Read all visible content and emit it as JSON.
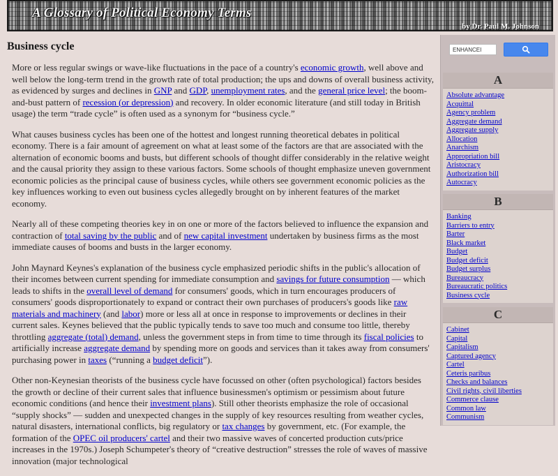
{
  "header": {
    "title": "A Glossary of Political Economy Terms",
    "author": "by Dr. Paul M. Johnson"
  },
  "article": {
    "title": "Business cycle",
    "p1": {
      "t1": "More or less regular swings or wave-like fluctuations in the pace of a country's ",
      "l1": "economic growth",
      "t2": ", well above and well below the long-term trend in the growth rate of total production; the ups and downs of overall business activity, as evidenced by surges and declines in ",
      "l2": "GNP",
      "t3": " and ",
      "l3": "GDP",
      "t4": ", ",
      "l4": "unemployment rates",
      "t5": ", and the ",
      "l5": "general price level",
      "t6": "; the boom-and-bust pattern of ",
      "l6": "recession (or depression)",
      "t7": " and recovery. In older economic literature (and still today in British usage) the term “trade cycle” is often used as a synonym for “business cycle.”"
    },
    "p2": "What causes business cycles has been one of the hottest and longest running theoretical debates in political economy. There is a fair amount of agreement on what at least some of the factors are that are associated with the alternation of economic booms and busts, but different schools of thought differ considerably in the relative weight and the causal priority they assign to these various factors. Some schools of thought emphasize uneven government economic policies as the principal cause of business cycles, while others see government economic policies as the key influences working to even out business cycles allegedly brought on by inherent features of the market economy.",
    "p3": {
      "t1": "Nearly all of these competing theories key in on one or more of the factors believed to influence the expansion and contraction of ",
      "l1": "total saving by the public",
      "t2": " and of ",
      "l2": "new capital investment",
      "t3": " undertaken by business firms as the most immediate causes of booms and busts in the larger economy."
    },
    "p4": {
      "t1": "John Maynard Keynes's explanation of the business cycle emphasized periodic shifts in the public's allocation of their incomes between current spending for immediate consumption and ",
      "l1": "savings for future consumption",
      "t2": " — which leads to shifts in the ",
      "l2": "overall level of demand",
      "t3": " for consumers' goods, which in turn encourages producers of consumers' goods disproportionately to expand or contract their own purchases of producers's goods like ",
      "l3": "raw materials and machinery",
      "t4": " (and ",
      "l4": "labor",
      "t5": ") more or less all at once in response to improvements or declines in their current sales. Keynes believed that the public typically tends to save too much and consume too little, thereby throttling ",
      "l5": "aggregate (total) demand",
      "t6": ", unless the government steps in from time to time through its ",
      "l6": "fiscal policies",
      "t7": " to artificially increase ",
      "l7": "aggregate demand",
      "t8": " by spending more on goods and services than it takes away from consumers' purchasing power in ",
      "l8": "taxes",
      "t9": " (“running a ",
      "l9": "budget deficit",
      "t10": "”)."
    },
    "p5": {
      "t1": "Other non-Keynesian theorists of the business cycle have focussed on other (often psychological) factors besides the growth or decline of their current sales that influence businessmen's optimism or pessimism about future economic conditions (and hence their ",
      "l1": "investment plans",
      "t2": "). Still other theorists emphasize the role of occasional “supply shocks” — sudden and unexpected changes in the supply of key resources resulting from weather cycles, natural disasters, international conflicts, big regulatory or ",
      "l2": "tax changes",
      "t3": " by government, etc. (For example, the formation of the ",
      "l3": "OPEC oil producers' cartel",
      "t4": " and their two massive waves of concerted production cuts/price increases in the 1970s.) Joseph Schumpeter's theory of “creative destruction” stresses the role of waves of massive innovation (major technological"
    }
  },
  "sidebar": {
    "search": {
      "value": "ENHANCEI"
    },
    "sections": [
      {
        "letter": "A",
        "items": [
          "Absolute advantage",
          "Acquittal",
          "Agency problem",
          "Aggregate demand",
          "Aggregate supply",
          "Allocation",
          "Anarchism",
          "Appropriation bill",
          "Aristocracy",
          "Authorization bill",
          "Autocracy"
        ]
      },
      {
        "letter": "B",
        "items": [
          "Banking",
          "Barriers to entry",
          "Barter",
          "Black market",
          "Budget",
          "Budget deficit",
          "Budget surplus",
          "Bureaucracy",
          "Bureaucratic politics",
          "Business cycle"
        ]
      },
      {
        "letter": "C",
        "items": [
          "Cabinet",
          "Capital",
          "Capitalism",
          "Captured agency",
          "Cartel",
          "Ceteris paribus",
          "Checks and balances",
          "Civil rights, civil liberties",
          "Commerce clause",
          "Common law",
          "Communism"
        ]
      }
    ]
  },
  "colors": {
    "link": "#0000cc",
    "background": "#e7dcd9",
    "sidebar": "#c8bcbc",
    "search_button": "#4787ed"
  }
}
